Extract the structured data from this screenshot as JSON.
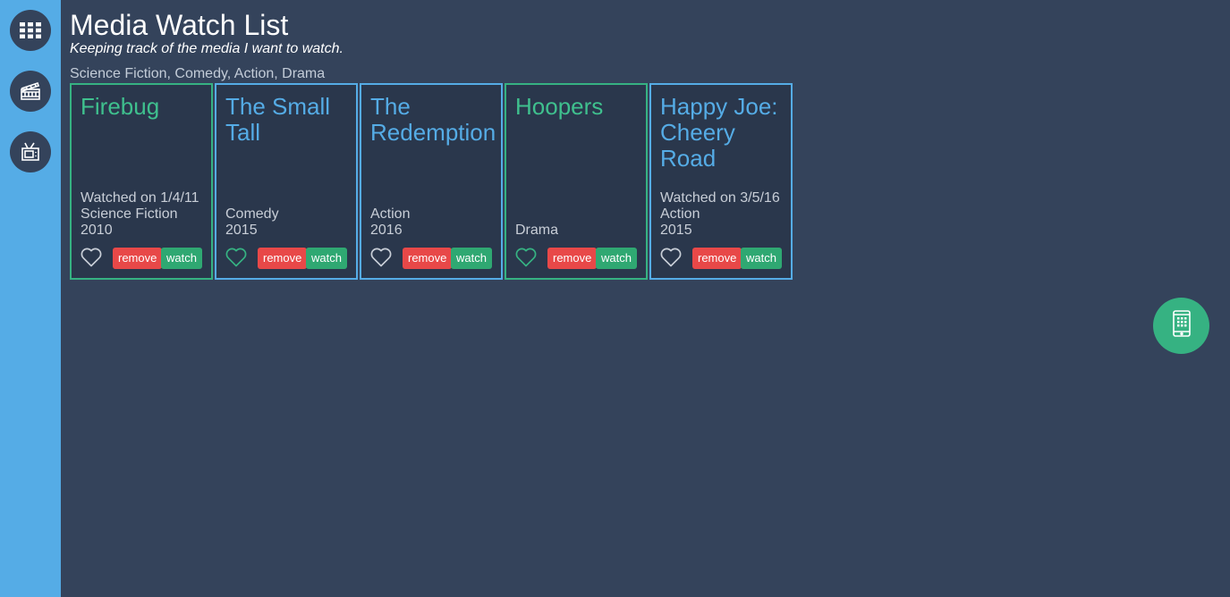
{
  "header": {
    "title": "Media Watch List",
    "subtitle": "Keeping track of the media I want to watch.",
    "genres": "Science Fiction, Comedy, Action, Drama"
  },
  "sidebar": {
    "items": [
      {
        "icon": "grid-icon"
      },
      {
        "icon": "film-icon"
      },
      {
        "icon": "tv-icon"
      }
    ]
  },
  "cards": [
    {
      "title": "Firebug",
      "watched": "Watched on 1/4/11",
      "genre": "Science Fiction",
      "year": "2010",
      "remove_label": "remove",
      "watch_label": "watch",
      "favorited": false,
      "title_color": "#3fc08e",
      "border_color": "#36b282"
    },
    {
      "title": "The Small Tall",
      "watched": "",
      "genre": "Comedy",
      "year": "2015",
      "remove_label": "remove",
      "watch_label": "watch",
      "favorited": true,
      "title_color": "#55ace6",
      "border_color": "#55ace6"
    },
    {
      "title": "The Redemption",
      "watched": "",
      "genre": "Action",
      "year": "2016",
      "remove_label": "remove",
      "watch_label": "watch",
      "favorited": false,
      "title_color": "#55ace6",
      "border_color": "#55ace6"
    },
    {
      "title": "Hoopers",
      "watched": "",
      "genre": "Drama",
      "year": "",
      "remove_label": "remove",
      "watch_label": "watch",
      "favorited": true,
      "title_color": "#3fc08e",
      "border_color": "#36b282"
    },
    {
      "title": "Happy Joe: Cheery Road",
      "watched": "Watched on 3/5/16",
      "genre": "Action",
      "year": "2015",
      "remove_label": "remove",
      "watch_label": "watch",
      "favorited": false,
      "title_color": "#55ace6",
      "border_color": "#55ace6"
    }
  ],
  "fab": {
    "icon": "mobile-device-icon"
  },
  "colors": {
    "background": "#34435b",
    "sidebar": "#55ace6",
    "accent_green": "#36b282",
    "accent_blue": "#55ace6",
    "remove_red": "#e84848"
  }
}
